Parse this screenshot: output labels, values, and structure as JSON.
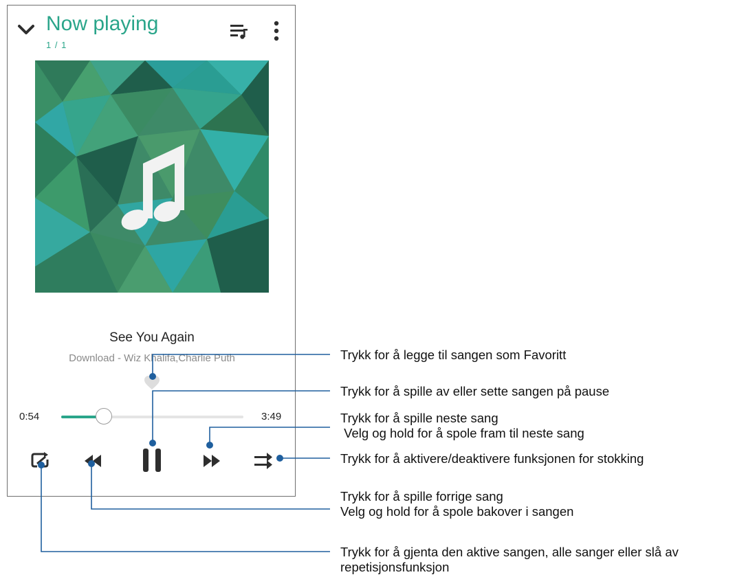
{
  "header": {
    "title": "Now playing",
    "counter": "1 / 1",
    "icons": {
      "back": "chevron-down-icon",
      "queue": "queue-music-icon",
      "more": "more-vert-icon"
    }
  },
  "artwork": {
    "icon": "music-note-icon"
  },
  "track": {
    "title": "See You Again",
    "artist": "Download - Wiz Khalifa,Charlie Puth"
  },
  "progress": {
    "elapsed": "0:54",
    "total": "3:49",
    "fraction": 0.235
  },
  "controls": {
    "favorite": "heart-icon",
    "repeat": "repeat-icon",
    "previous": "rewind-icon",
    "play_pause": "pause-icon",
    "next": "fast-forward-icon",
    "shuffle": "shuffle-icon"
  },
  "colors": {
    "accent": "#2aa58a",
    "callout_line": "#1f5f9e",
    "icon": "#2e2e2e"
  },
  "callouts": {
    "favorite": [
      "Trykk for å legge til sangen som Favoritt"
    ],
    "play_pause": [
      "Trykk for å spille av eller sette sangen på pause"
    ],
    "next": [
      "Trykk for å spille neste sang",
      " Velg og hold for å spole fram til neste sang"
    ],
    "shuffle": [
      "Trykk for å aktivere/deaktivere funksjonen for stokking"
    ],
    "previous": [
      "Trykk for å spille forrige sang",
      "Velg og hold for å spole bakover i sangen"
    ],
    "repeat": [
      "Trykk for å gjenta den aktive sangen, alle sanger eller slå av",
      "repetisjonsfunksjon"
    ]
  }
}
